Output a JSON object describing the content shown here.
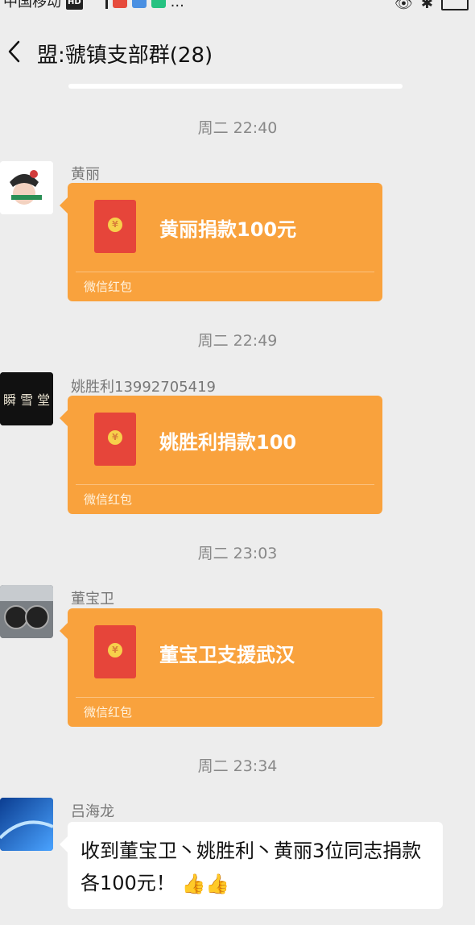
{
  "statusbar": {
    "carrier": "中国移动",
    "network": "HD",
    "dots": "..."
  },
  "header": {
    "title": "盟:虢镇支部群(28)"
  },
  "messages": [
    {
      "timestamp": "周二 22:40",
      "sender": "黄丽",
      "type": "red_packet",
      "text": "黄丽捐款100元",
      "footer": "微信红包",
      "avatar_color": "#ffffff"
    },
    {
      "timestamp": "周二 22:49",
      "sender": "姚胜利13992705419",
      "type": "red_packet",
      "text": "姚胜利捐款100",
      "footer": "微信红包",
      "avatar_color": "#111111"
    },
    {
      "timestamp": "周二 23:03",
      "sender": "董宝卫",
      "type": "red_packet",
      "text": "董宝卫支援武汉",
      "footer": "微信红包",
      "avatar_color": "#6b6f73"
    },
    {
      "timestamp": "周二 23:34",
      "sender": "吕海龙",
      "type": "text",
      "text": "收到董宝卫丶姚胜利丶黄丽3位同志捐款各100元！",
      "emoji": "👍👍",
      "avatar_color": "#1f5fbf"
    }
  ],
  "colors": {
    "background": "#ededed",
    "red_packet": "#f9a23d",
    "envelope": "#e6453a"
  },
  "icons": [
    "back-chevron-icon",
    "red-envelope-icon",
    "thumbs-up-icon"
  ]
}
